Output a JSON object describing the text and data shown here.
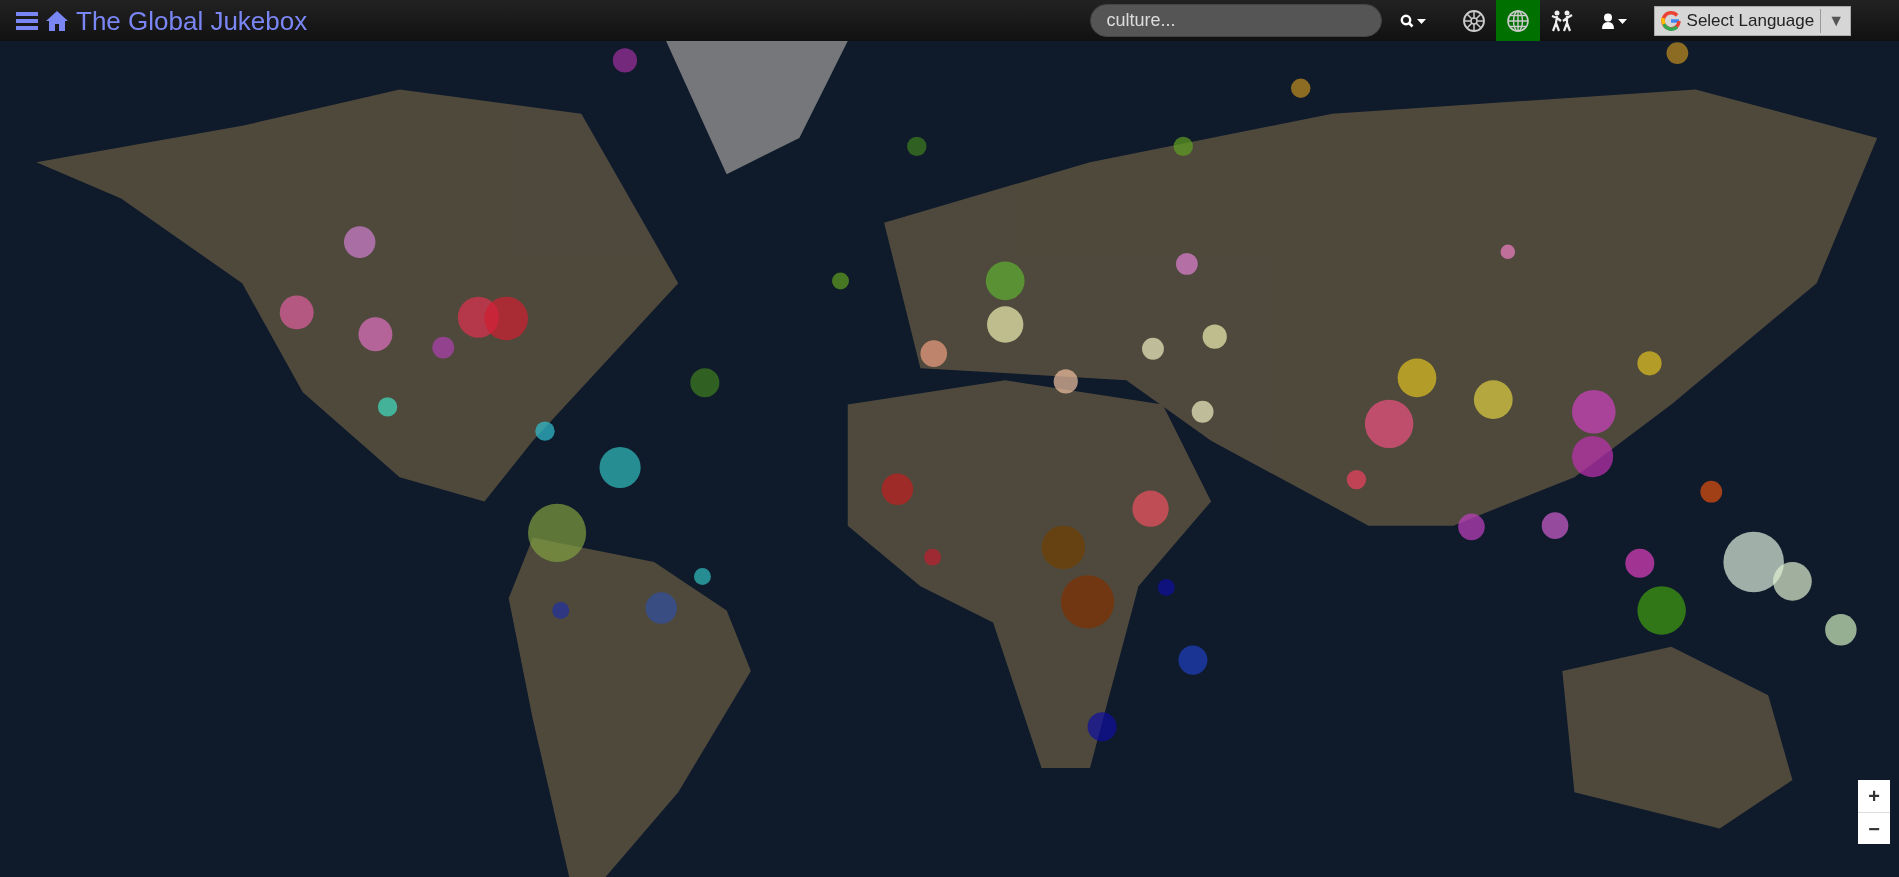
{
  "app": {
    "title": "The Global Jukebox"
  },
  "search": {
    "placeholder": "culture..."
  },
  "views": [
    {
      "kind": "wheel",
      "selected": false
    },
    {
      "kind": "globe",
      "selected": true
    },
    {
      "kind": "dancers",
      "selected": false
    }
  ],
  "language_select": {
    "label": "Select Language",
    "arrow": "▼"
  },
  "zoom_controls": [
    "+",
    "−"
  ]
}
